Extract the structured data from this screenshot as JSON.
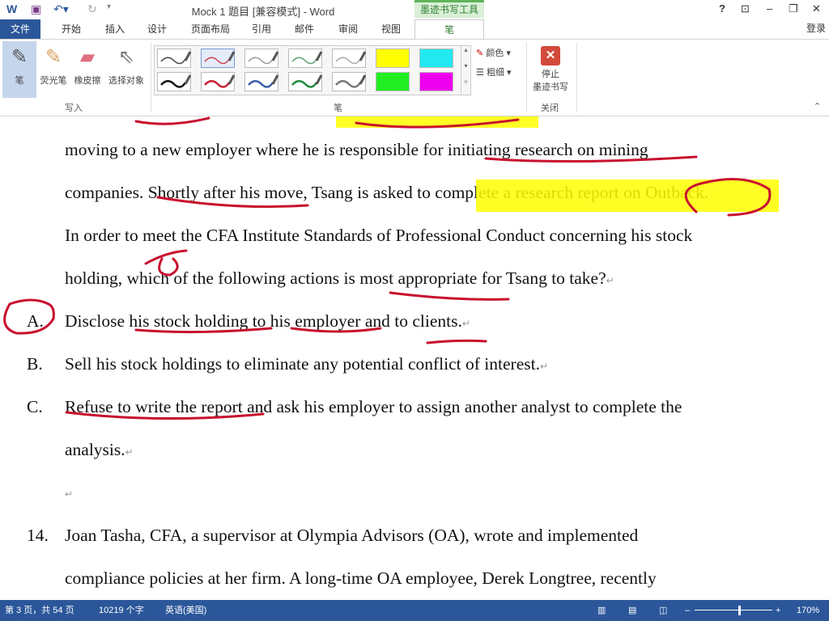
{
  "titlebar": {
    "title": "Mock 1 题目 [兼容模式] - Word",
    "ink_tools": "墨迹书写工具",
    "help": "?",
    "minimize": "–",
    "restore": "❐",
    "close": "✕",
    "ribbon_display": "⊡"
  },
  "tabs": [
    {
      "label": "文件"
    },
    {
      "label": "开始"
    },
    {
      "label": "插入"
    },
    {
      "label": "设计"
    },
    {
      "label": "页面布局"
    },
    {
      "label": "引用"
    },
    {
      "label": "邮件"
    },
    {
      "label": "审阅"
    },
    {
      "label": "视图"
    },
    {
      "label": "笔"
    }
  ],
  "signin": "登录",
  "ribbon": {
    "write_group": "写入",
    "pen_group": "笔",
    "close_group": "关闭",
    "pen": "笔",
    "highlighter": "荧光笔",
    "eraser": "橡皮擦",
    "select": "选择对象",
    "color": "颜色",
    "thickness": "粗细",
    "stop_inking": "停止",
    "stop_inking2": "墨迹书写",
    "swatches_row1": [
      "#444444",
      "#d04050",
      "#999999",
      "#5aa070",
      "#aaaaaa",
      "#ffff00",
      "#22e8f0"
    ],
    "swatches_row2": [
      "#111111",
      "#c82030",
      "#3a5ea8",
      "#1f8a3a",
      "#777777",
      "#22ee22",
      "#ee00ee"
    ]
  },
  "document": {
    "lines": [
      "moving to a new employer where he is responsible for initiating research on mining",
      "companies. Shortly after his move, Tsang is asked to complete a research report on Outback.",
      "In order to meet the CFA Institute Standards of Professional Conduct concerning his stock",
      "holding, which of the following actions is most appropriate for Tsang to take?"
    ],
    "options": [
      {
        "label": "A.",
        "text": "Disclose his stock holding to his employer and to clients."
      },
      {
        "label": "B.",
        "text": "Sell his stock holdings to eliminate any potential conflict of interest."
      },
      {
        "label": "C.",
        "text": "Refuse to write the report and ask his employer to assign another analyst to complete the"
      }
    ],
    "option_c_cont": "analysis.",
    "q14_label": "14.",
    "q14_lines": [
      "Joan Tasha, CFA, a supervisor at Olympia Advisors (OA), wrote and implemented",
      "compliance policies at her firm. A long-time OA employee, Derek Longtree, recently"
    ],
    "para_mark": "↵"
  },
  "status": {
    "page": "第 3 页，共 54 页",
    "words": "10219 个字",
    "language": "英语(美国)",
    "zoom": "170%"
  }
}
